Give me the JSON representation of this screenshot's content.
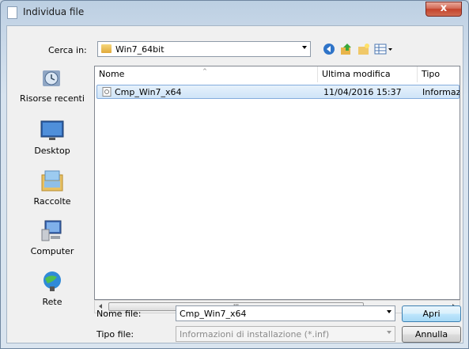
{
  "window": {
    "title": "Individua file",
    "close_glyph": "x"
  },
  "toolbar": {
    "look_in_label": "Cerca in:",
    "look_in_value": "Win7_64bit",
    "icons": [
      "back-icon",
      "up-folder-icon",
      "new-folder-icon",
      "view-menu-icon"
    ]
  },
  "places": [
    {
      "label": "Risorse recenti",
      "icon": "recent-places-icon"
    },
    {
      "label": "Desktop",
      "icon": "desktop-icon"
    },
    {
      "label": "Raccolte",
      "icon": "libraries-icon"
    },
    {
      "label": "Computer",
      "icon": "computer-icon"
    },
    {
      "label": "Rete",
      "icon": "network-icon"
    }
  ],
  "file_list": {
    "columns": [
      "Nome",
      "Ultima modifica",
      "Tipo"
    ],
    "rows": [
      {
        "name": "Cmp_Win7_x64",
        "modified": "11/04/2016 15:37",
        "type": "Informazi",
        "selected": true
      }
    ]
  },
  "scrollbar": {
    "thumb_grip": "III"
  },
  "bottom": {
    "filename_label": "Nome file:",
    "filename_value": "Cmp_Win7_x64",
    "filetype_label": "Tipo file:",
    "filetype_value": "Informazioni di installazione (*.inf)",
    "open_label": "Apri",
    "cancel_label": "Annulla"
  },
  "colors": {
    "accent": "#3c7fb1",
    "close": "#c4432b",
    "selection": "#cfe4f8"
  }
}
